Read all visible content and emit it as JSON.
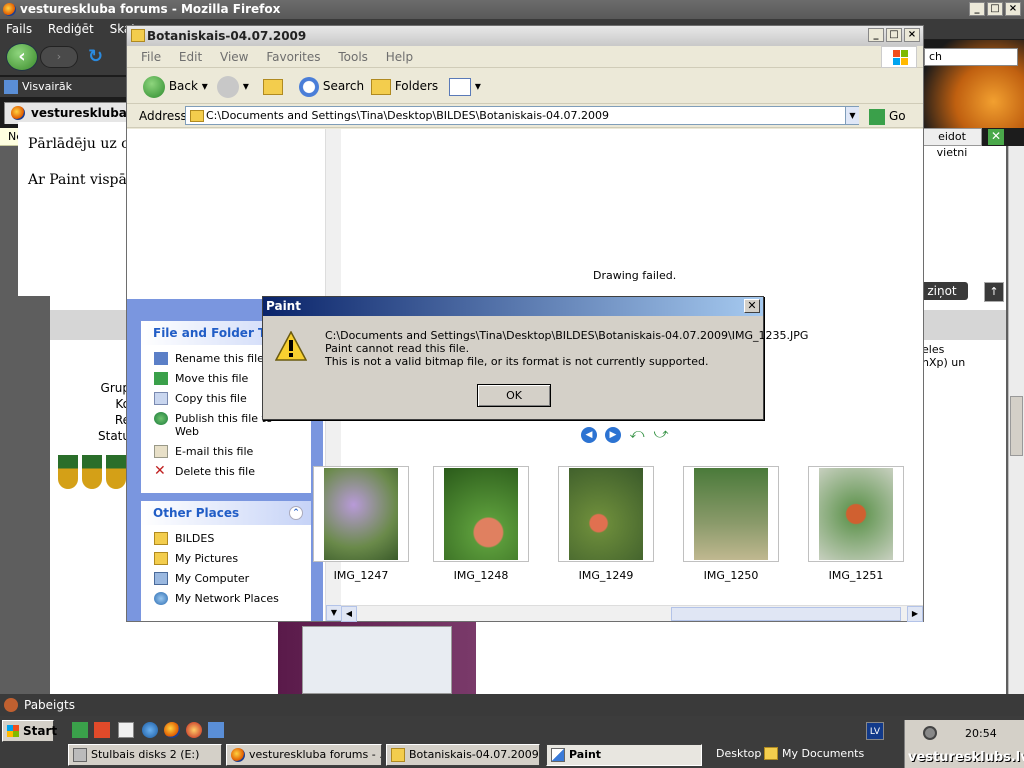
{
  "firefox": {
    "title": "vestureskluba forums - Mozilla Firefox",
    "menu": [
      "Fails",
      "Rediģēt",
      "Skats"
    ],
    "bookmark": "Visvairāk apmeklētās",
    "tab": "vestureskluba fo",
    "notification_prefix": "Ne",
    "status": "Pabeigts",
    "search_partial": "ch",
    "right_edit_button": "eidot vietni",
    "zinot_button": "ziņot",
    "right_text": [
      "eles",
      "nXp) un"
    ],
    "left_labels": [
      "Grup",
      "Ko",
      "Re",
      "Statu"
    ]
  },
  "post": {
    "line1": "Pārlādēju uz cieto c:, nekas nenotiek.",
    "line2": "Ar Paint vispār nevar atvērt."
  },
  "explorer": {
    "title": "Botaniskais-04.07.2009",
    "menu": [
      "File",
      "Edit",
      "View",
      "Favorites",
      "Tools",
      "Help"
    ],
    "toolbar": {
      "back": "Back",
      "search": "Search",
      "folders": "Folders"
    },
    "address_label": "Address",
    "address_value": "C:\\Documents and Settings\\Tina\\Desktop\\BILDES\\Botaniskais-04.07.2009",
    "go": "Go",
    "drawing_failed": "Drawing failed.",
    "file_tasks": {
      "title": "File and Folder Task",
      "items": [
        "Rename this file",
        "Move this file",
        "Copy this file",
        "Publish this file to",
        "Web",
        "E-mail this file",
        "Delete this file"
      ]
    },
    "other_places": {
      "title": "Other Places",
      "items": [
        "BILDES",
        "My Pictures",
        "My Computer",
        "My Network Places"
      ]
    },
    "thumbnails": [
      "IMG_1247",
      "IMG_1248",
      "IMG_1249",
      "IMG_1250",
      "IMG_1251"
    ]
  },
  "dialog": {
    "title": "Paint",
    "path": "C:\\Documents and Settings\\Tina\\Desktop\\BILDES\\Botaniskais-04.07.2009\\IMG_1235.JPG",
    "line2": "Paint cannot read this file.",
    "line3": "This is not a valid bitmap file, or its format is not currently supported.",
    "ok": "OK"
  },
  "taskbar": {
    "start": "Start",
    "buttons": [
      "Stulbais disks 2 (E:)",
      "vestureskluba forums - ...",
      "Botaniskais-04.07.2009",
      "Paint"
    ],
    "desktop": "Desktop",
    "my_documents": "My Documents",
    "lang": "LV",
    "clock": "20:54",
    "watermark": "vesturesklubs.lv"
  }
}
